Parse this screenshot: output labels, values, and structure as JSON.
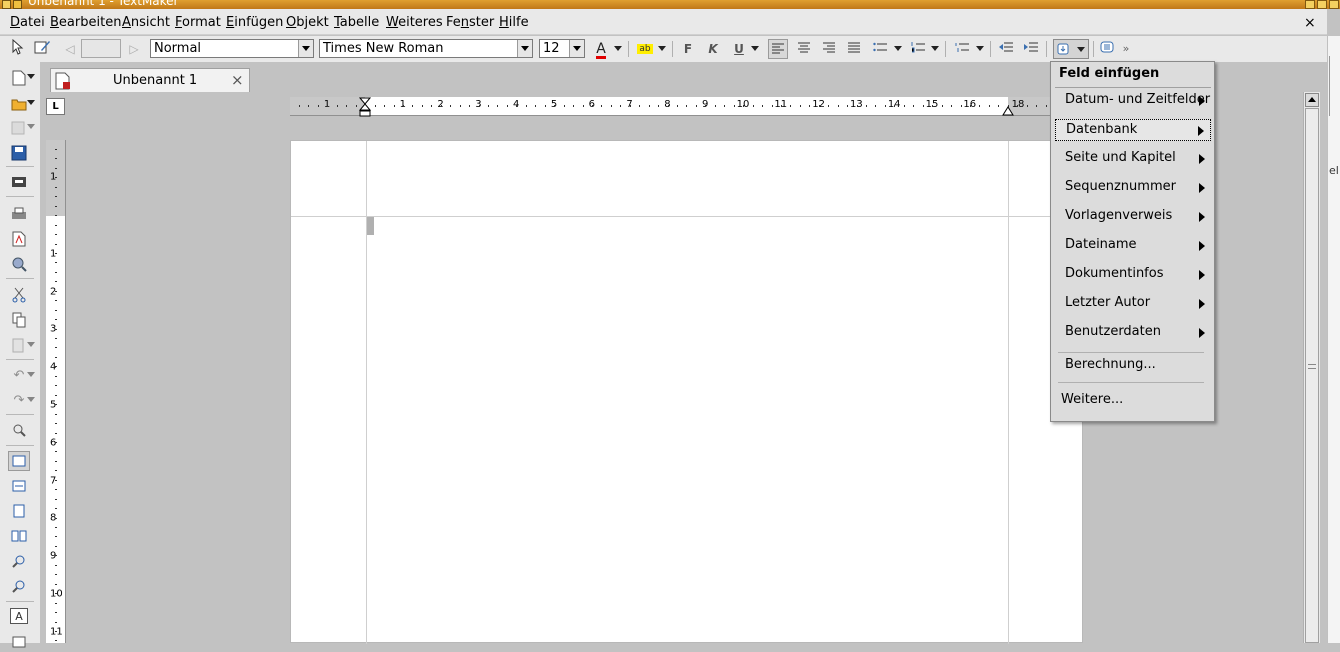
{
  "window": {
    "title": "Unbenannt 1 - TextMaker"
  },
  "menubar": {
    "items": [
      "Datei",
      "Bearbeiten",
      "Ansicht",
      "Format",
      "Einfügen",
      "Objekt",
      "Tabelle",
      "Weiteres",
      "Fenster",
      "Hilfe"
    ],
    "close": "×"
  },
  "toolbar": {
    "style_value": "Normal",
    "font_value": "Times New Roman",
    "size_value": "12",
    "font_color_label": "A",
    "highlight_label": "ab",
    "bold_label": "F",
    "italic_label": "K",
    "underline_label": "U",
    "overflow_label": "»"
  },
  "tab": {
    "label": "Unbenannt 1",
    "close": "×"
  },
  "ruler": {
    "corner_label": "L",
    "h_numbers": [
      "1",
      "1",
      "2",
      "3",
      "4",
      "5",
      "6",
      "7",
      "8",
      "9",
      "10",
      "11",
      "12",
      "13",
      "14",
      "15",
      "16",
      "18"
    ],
    "v_numbers": [
      "1",
      "1",
      "2",
      "3",
      "4",
      "5",
      "6",
      "7",
      "8",
      "9",
      "10",
      "11"
    ]
  },
  "context_menu": {
    "title": "Feld einfügen",
    "items": [
      {
        "label": "Datum- und Zeitfelder",
        "submenu": true
      },
      {
        "label": "Datenbank",
        "submenu": true,
        "selected": true
      },
      {
        "label": "Seite und Kapitel",
        "submenu": true
      },
      {
        "label": "Sequenznummer",
        "submenu": true
      },
      {
        "label": "Vorlagenverweis",
        "submenu": true
      },
      {
        "label": "Dateiname",
        "submenu": true
      },
      {
        "label": "Dokumentinfos",
        "submenu": true
      },
      {
        "label": "Letzter Autor",
        "submenu": true
      },
      {
        "label": "Benutzerdaten",
        "submenu": true
      },
      {
        "label": "Berechnung...",
        "submenu": false
      },
      {
        "label": "Weitere...",
        "submenu": false
      }
    ]
  },
  "side_text": "el"
}
